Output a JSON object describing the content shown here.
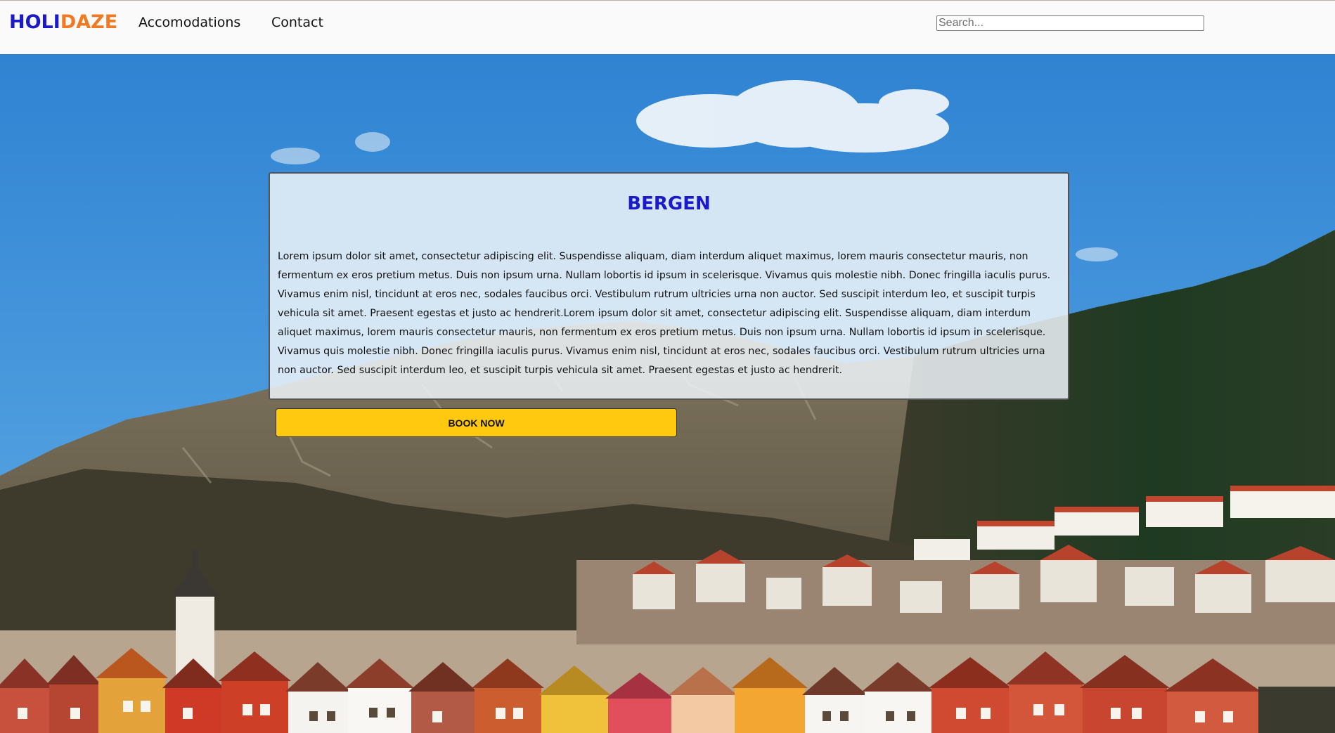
{
  "brand": {
    "part1": "HOLI",
    "part2": "DAZE",
    "color1": "#1a1ac8",
    "color2": "#f07a23"
  },
  "nav": {
    "items": [
      {
        "label": "Accomodations"
      },
      {
        "label": "Contact"
      }
    ]
  },
  "search": {
    "placeholder": "Search..."
  },
  "card": {
    "title": "BERGEN",
    "body": "Lorem ipsum dolor sit amet, consectetur adipiscing elit. Suspendisse aliquam, diam interdum aliquet maximus, lorem mauris consectetur mauris, non fermentum ex eros pretium metus. Duis non ipsum urna. Nullam lobortis id ipsum in scelerisque. Vivamus quis molestie nibh. Donec fringilla iaculis purus. Vivamus enim nisl, tincidunt at eros nec, sodales faucibus orci. Vestibulum rutrum ultricies urna non auctor. Sed suscipit interdum leo, et suscipit turpis vehicula sit amet. Praesent egestas et justo ac hendrerit.Lorem ipsum dolor sit amet, consectetur adipiscing elit. Suspendisse aliquam, diam interdum aliquet maximus, lorem mauris consectetur mauris, non fermentum ex eros pretium metus. Duis non ipsum urna. Nullam lobortis id ipsum in scelerisque. Vivamus quis molestie nibh. Donec fringilla iaculis purus. Vivamus enim nisl, tincidunt at eros nec, sodales faucibus orci. Vestibulum rutrum ultricies urna non auctor. Sed suscipit interdum leo, et suscipit turpis vehicula sit amet. Praesent egestas et justo ac hendrerit."
  },
  "cta": {
    "label": "BOOK NOW",
    "color": "#fec90e"
  },
  "colors": {
    "title": "#1a1acb",
    "sky": "#3f8fd6"
  }
}
